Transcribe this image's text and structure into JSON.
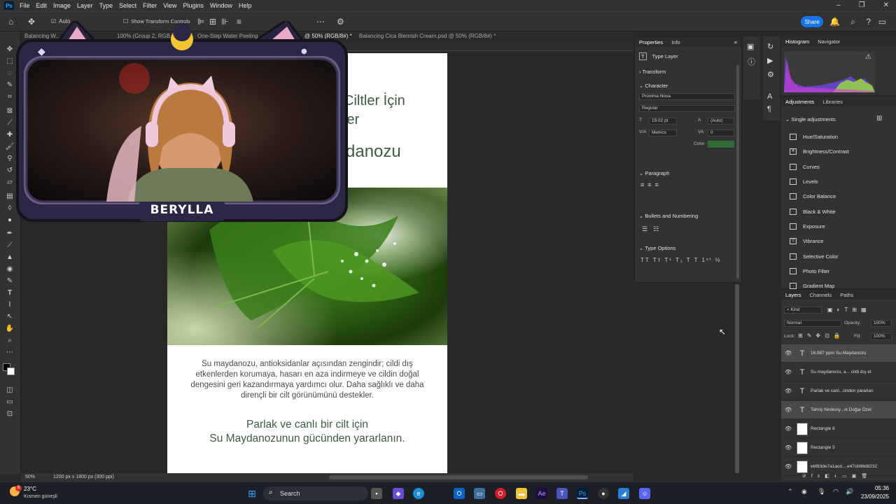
{
  "menubar": {
    "items": [
      "File",
      "Edit",
      "Image",
      "Layer",
      "Type",
      "Select",
      "Filter",
      "View",
      "Plugins",
      "Window",
      "Help"
    ],
    "window_controls": [
      "–",
      "❐",
      "✕"
    ]
  },
  "options_bar": {
    "auto_select_label": "Auto",
    "show_transform_label": "Show Transform Controls",
    "share_label": "Share"
  },
  "tabs": [
    {
      "label": "Balancing W...",
      "state": "inactive"
    },
    {
      "label": "100% (Group 2, RGB...",
      "state": "inactive"
    },
    {
      "label": "One-Step Water Peeling...",
      "state": "inactive"
    },
    {
      "label": "@ 50% (RGB/8#) *",
      "state": "active"
    },
    {
      "label": "Balancing Cica Blemish Cream.psd @ 50% (RGB/8#) *",
      "state": "inactive"
    }
  ],
  "document": {
    "heading_line1": "i Ciltler İçin",
    "heading_line2": "zler",
    "heading_line3": "ydanozu",
    "body_text": "Su maydanozu, antioksidanlar açısından zengindir; cildi dış etkenlerden korumaya, hasarı en aza indirmeye ve cildin doğal dengesini geri kazandırmaya yardımcı olur. Daha sağlıklı ve daha dirençli bir cilt görünümünü destekler.",
    "sub_line1": "Parlak ve canlı bir cilt için",
    "sub_line2": "Su Maydanozunun gücünden yararlanın."
  },
  "webcam": {
    "streamer_name": "BERYLLA"
  },
  "properties": {
    "tabs": [
      "Properties",
      "Info"
    ],
    "type_layer_label": "Type Layer",
    "transform_label": "Transform",
    "character_label": "Character",
    "font_family": "Proxima Nova",
    "font_style": "Regular",
    "font_size": "19.02 pt",
    "leading": "(Auto)",
    "kerning": "Metrics",
    "tracking": "0",
    "color_label": "Color",
    "color_value": "#2e6b36",
    "paragraph_label": "Paragraph",
    "bullets_label": "Bullets and Numbering",
    "type_options_label": "Type Options",
    "type_options_glyphs": "TT Tт T¹ T₁ T T 1ˢᵗ ½"
  },
  "histogram": {
    "tabs": [
      "Histogram",
      "Navigator"
    ]
  },
  "adjustments": {
    "tabs": [
      "Adjustments",
      "Libraries"
    ],
    "section_label": "Single adjustments",
    "items": [
      "Hue/Saturation",
      "Brightness/Contrast",
      "Curves",
      "Levels",
      "Color Balance",
      "Black & White",
      "Exposure",
      "Vibrance",
      "Selective Color",
      "Photo Filter",
      "Gradient Map"
    ]
  },
  "layers": {
    "tabs": [
      "Layers",
      "Channels",
      "Paths"
    ],
    "filter_label": "Kind",
    "blend_mode": "Normal",
    "opacity_label": "Opacity:",
    "opacity_value": "100%",
    "lock_label": "Lock:",
    "fill_label": "Fill:",
    "fill_value": "100%",
    "rows": [
      {
        "name": "16,987 ppm Su Maydanozu",
        "kind": "T",
        "selected": true
      },
      {
        "name": "Su maydanozu, a... cildi dış et",
        "kind": "T",
        "selected": false
      },
      {
        "name": "Parlak ve canl...ünden yararlan",
        "kind": "T",
        "selected": false
      },
      {
        "name": "Tahriş Nedeniy...ık Doğal Özel",
        "kind": "T",
        "selected": true
      },
      {
        "name": "Rectangle 6",
        "kind": "box",
        "selected": false
      },
      {
        "name": "Rectangle 5",
        "kind": "box",
        "selected": false
      },
      {
        "name": "ebf83de7a1acd....e47cb96d8232",
        "kind": "box",
        "selected": false
      }
    ]
  },
  "status": {
    "zoom": "50%",
    "doc_size": "1200 px x 1800 px (300 ppi)"
  },
  "taskbar": {
    "temperature": "23°C",
    "weather": "Kısmen güneşli",
    "weather_badge": "6",
    "search_label": "Search",
    "time": "05:36",
    "date": "23/09/2025"
  }
}
